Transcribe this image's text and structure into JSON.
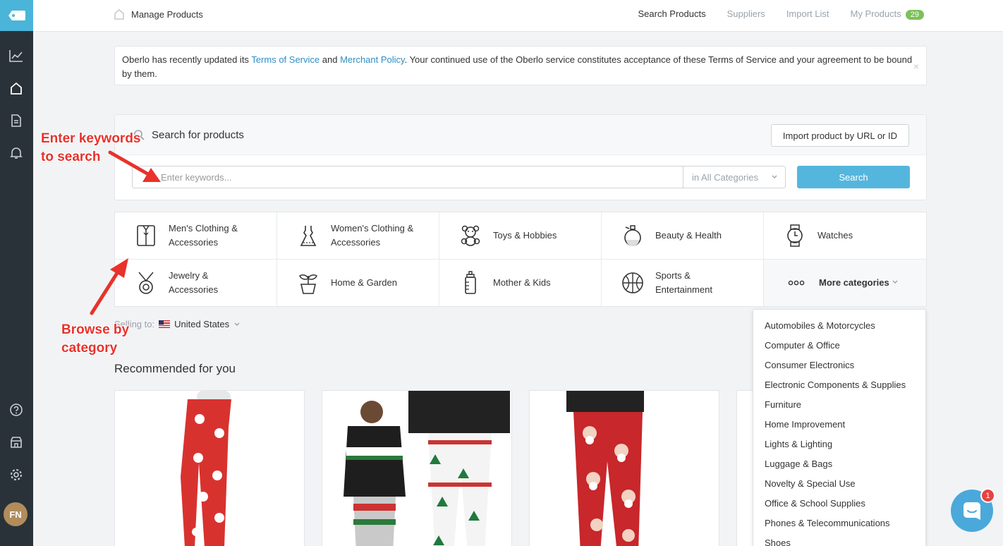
{
  "sidebar": {
    "logo_icon": "tag-icon",
    "items": [
      {
        "name": "analytics",
        "icon": "chart-icon"
      },
      {
        "name": "home",
        "icon": "home-icon"
      },
      {
        "name": "documents",
        "icon": "document-icon"
      },
      {
        "name": "notifications",
        "icon": "bell-icon"
      },
      {
        "name": "help",
        "icon": "help-icon"
      },
      {
        "name": "store",
        "icon": "store-icon"
      },
      {
        "name": "settings",
        "icon": "gear-icon"
      }
    ],
    "avatar_initials": "FN"
  },
  "topbar": {
    "breadcrumb": "Manage Products",
    "nav": {
      "search_products": "Search Products",
      "suppliers": "Suppliers",
      "import_list": "Import List",
      "my_products": "My Products",
      "my_products_count": "29"
    }
  },
  "notice": {
    "text_1": "Oberlo has recently updated its ",
    "terms_link": "Terms of Service",
    "text_2": " and ",
    "merchant_link": "Merchant Policy",
    "text_3": ". Your continued use of the Oberlo service constitutes acceptance of these Terms of Service and your agreement to be bound by them.",
    "close": "×"
  },
  "search": {
    "title": "Search for products",
    "import_button": "Import product by URL or ID",
    "placeholder": "Enter keywords...",
    "category_select": "in All Categories",
    "search_button": "Search"
  },
  "categories": {
    "mens": "Men's Clothing & Accessories",
    "womens": "Women's Clothing & Accessories",
    "toys": "Toys & Hobbies",
    "beauty": "Beauty & Health",
    "watches": "Watches",
    "jewelry": "Jewelry & Accessories",
    "home": "Home & Garden",
    "mother": "Mother & Kids",
    "sports": "Sports & Entertainment",
    "more": "More categories"
  },
  "selling": {
    "label": "Selling to:",
    "country": "United States"
  },
  "recommended_title": "Recommended for you",
  "dropdown": {
    "items": [
      "Automobiles & Motorcycles",
      "Computer & Office",
      "Consumer Electronics",
      "Electronic Components & Supplies",
      "Furniture",
      "Home Improvement",
      "Lights & Lighting",
      "Luggage & Bags",
      "Novelty & Special Use",
      "Office & School Supplies",
      "Phones & Telecommunications",
      "Shoes"
    ]
  },
  "annotations": {
    "search_line1": "Enter keywords",
    "search_line2": "to search",
    "browse_line1": "Browse by",
    "browse_line2": "category"
  },
  "chat": {
    "unread": "1"
  },
  "colors": {
    "accent": "#55b6dd",
    "sidebar": "#2a3239",
    "badge_green": "#7dc05b",
    "annotation_red": "#e8322b"
  }
}
